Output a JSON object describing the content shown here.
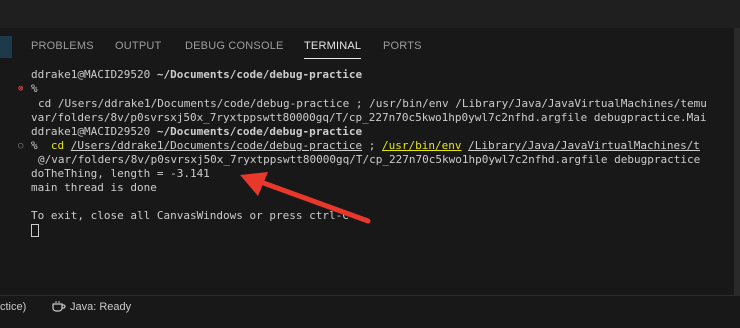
{
  "panel_tabs": [
    {
      "label": "PROBLEMS"
    },
    {
      "label": "OUTPUT"
    },
    {
      "label": "DEBUG CONSOLE"
    },
    {
      "label": "TERMINAL"
    },
    {
      "label": "PORTS"
    }
  ],
  "active_tab": "TERMINAL",
  "terminal": {
    "prompt1_host": "ddrake1@MACID29520",
    "prompt1_path": "~/Documents/code/debug-practice",
    "prompt_symbol": "%",
    "cmd1_line1": "cd /Users/ddrake1/Documents/code/debug-practice ; /usr/bin/env /Library/Java/JavaVirtualMachines/temu",
    "cmd1_line2": "var/folders/8v/p0svrsxj50x_7ryxtppswtt80000gq/T/cp_227n70c5kwo1hp0ywl7c2nfhd.argfile debugpractice.Mai",
    "prompt2_host": "ddrake1@MACID29520",
    "prompt2_path": "~/Documents/code/debug-practice",
    "cmd2_cd": "cd",
    "cmd2_dir": "/Users/ddrake1/Documents/code/debug-practice",
    "cmd2_sep": ";",
    "cmd2_env": "/usr/bin/env",
    "cmd2_java": "/Library/Java/JavaVirtualMachines/t",
    "cmd2_line2": "@/var/folders/8v/p0svrsxj50x_7ryxtppswtt80000gq/T/cp_227n70c5kwo1hp0ywl7c2nfhd.argfile debugpractice",
    "output1": "doTheThing, length = -3.141",
    "output2": "main thread is done",
    "output3": "To exit, close all CanvasWindows or press ctrl-C"
  },
  "status": {
    "left_fragment": "ctice)",
    "java_status": "Java: Ready"
  },
  "colors": {
    "background": "#181818",
    "arrow": "#e8372b",
    "error_marker": "#f14c4c",
    "env_highlight": "#e5e510"
  },
  "icons": [
    "error-circle-icon",
    "success-circle-icon",
    "coffee-cup-icon",
    "red-arrow"
  ]
}
